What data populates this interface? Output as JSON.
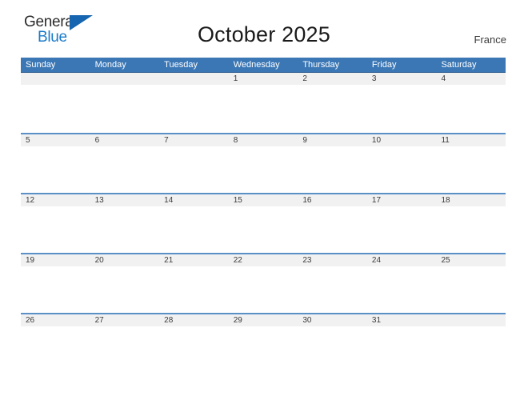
{
  "brand": {
    "name_part1": "General",
    "name_part2": "Blue",
    "triangle_icon": "blue-triangle-icon",
    "color_dark": "#2b2b2b",
    "color_blue": "#1a7ac8"
  },
  "header": {
    "title": "October 2025",
    "region": "France"
  },
  "colors": {
    "header_blue": "#3b77b5",
    "row_rule_blue": "#5a90c5",
    "day_band_gray": "#f1f1f1",
    "page_background": "#ffffff"
  },
  "calendar": {
    "month": "October",
    "year": "2025",
    "weekday_headers": [
      "Sunday",
      "Monday",
      "Tuesday",
      "Wednesday",
      "Thursday",
      "Friday",
      "Saturday"
    ],
    "weeks": [
      {
        "days": [
          "",
          "",
          "",
          "1",
          "2",
          "3",
          "4"
        ]
      },
      {
        "days": [
          "5",
          "6",
          "7",
          "8",
          "9",
          "10",
          "11"
        ]
      },
      {
        "days": [
          "12",
          "13",
          "14",
          "15",
          "16",
          "17",
          "18"
        ]
      },
      {
        "days": [
          "19",
          "20",
          "21",
          "22",
          "23",
          "24",
          "25"
        ]
      },
      {
        "days": [
          "26",
          "27",
          "28",
          "29",
          "30",
          "31",
          ""
        ]
      }
    ]
  }
}
